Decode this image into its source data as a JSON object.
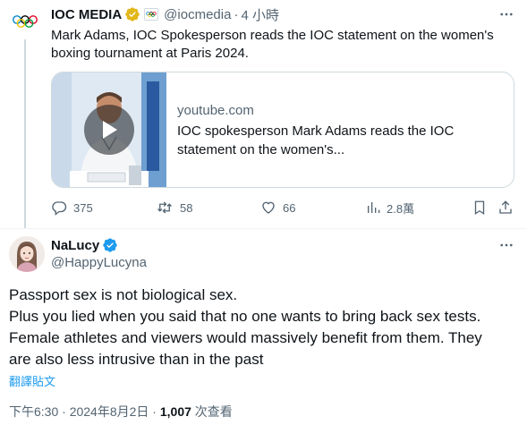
{
  "quoted_tweet": {
    "author_name": "IOC MEDIA",
    "handle": "@iocmedia",
    "separator": "·",
    "time": "4 小時",
    "text": "Mark Adams, IOC Spokesperson reads the IOC statement on the women's boxing tournament at Paris 2024.",
    "card": {
      "domain": "youtube.com",
      "title": "IOC spokesperson Mark Adams reads the IOC statement on the women's..."
    },
    "stats": {
      "replies": "375",
      "retweets": "58",
      "likes": "66",
      "views": "2.8萬"
    }
  },
  "main_tweet": {
    "author_name": "NaLucy",
    "handle": "@HappyLucyna",
    "text_lines": [
      "Passport sex is not biological sex.",
      "Plus you lied when you said that no one wants to bring back sex tests.",
      "Female athletes and viewers would massively benefit from them. They",
      "are also less intrusive than in the past"
    ],
    "translate_label": "翻譯貼文",
    "timestamp": "下午6:30 · 2024年8月2日 · ",
    "view_count": "1,007",
    "view_label": " 次查看"
  },
  "colors": {
    "text_primary": "#0f1419",
    "text_secondary": "#536471",
    "accent_blue": "#1d9bf0",
    "verified_gold": "#e2b719",
    "border": "#cfd9de"
  },
  "icons": [
    "olympic-rings-icon",
    "verified-gold-badge-icon",
    "affiliate-badge-icon",
    "more-options-icon",
    "play-icon",
    "reply-icon",
    "retweet-icon",
    "like-icon",
    "views-icon",
    "bookmark-icon",
    "share-icon",
    "verified-blue-badge-icon"
  ]
}
